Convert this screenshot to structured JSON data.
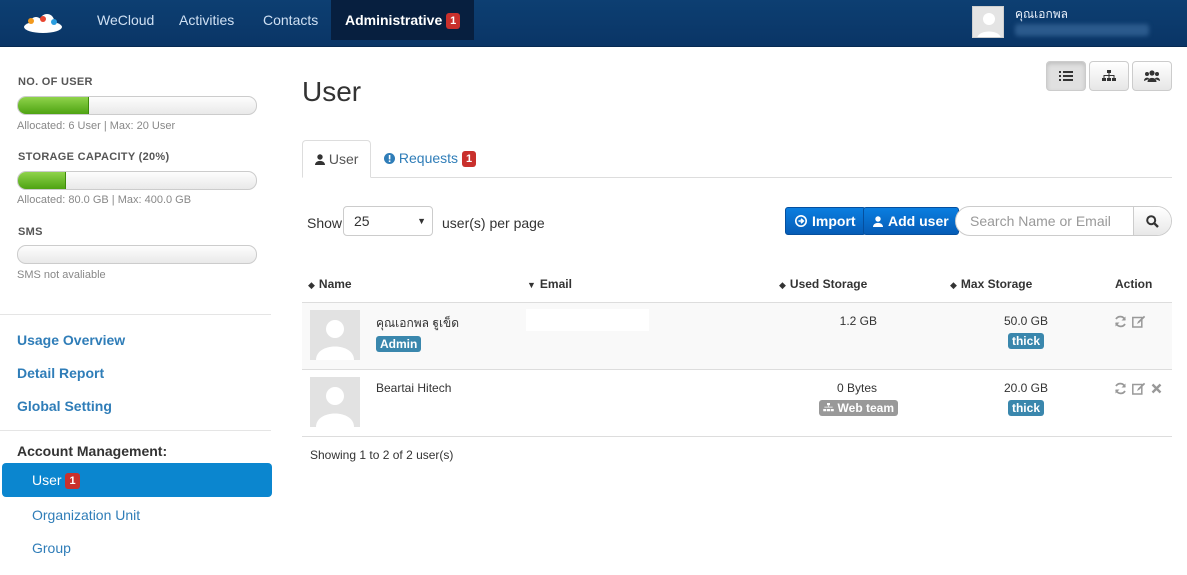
{
  "nav": {
    "items": [
      {
        "label": "WeCloud"
      },
      {
        "label": "Activities"
      },
      {
        "label": "Contacts"
      },
      {
        "label": "Administrative",
        "badge": "1"
      }
    ],
    "user_name": "คุณเอกพล",
    "logo_icon": "cloud-logo-icon"
  },
  "sidebar": {
    "users_meter": {
      "label": "NO. OF USER",
      "fill": 0.3,
      "caption": "Allocated: 6 User | Max: 20 User"
    },
    "storage_meter": {
      "label": "STORAGE CAPACITY (20%)",
      "fill": 0.2,
      "caption": "Allocated: 80.0 GB | Max: 400.0 GB"
    },
    "sms_meter": {
      "label": "SMS",
      "fill": 0,
      "caption": "SMS not avaliable"
    },
    "links": [
      "Usage Overview",
      "Detail Report",
      "Global Setting"
    ],
    "account_heading": "Account Management:",
    "active_item": {
      "label": "User",
      "badge": "1"
    },
    "sub_items": [
      "Organization Unit",
      "Group"
    ]
  },
  "main": {
    "title": "User",
    "tabs": [
      {
        "label": "User",
        "icon": "user-icon"
      },
      {
        "label": "Requests",
        "icon": "info-circle-icon",
        "badge": "1"
      }
    ],
    "show_label": "Show",
    "per_page_value": "25",
    "per_page_label": "user(s) per page",
    "import_label": "Import",
    "add_user_label": "Add user",
    "search_placeholder": "Search Name or Email",
    "columns": [
      "Name",
      "Email",
      "Used Storage",
      "Max Storage",
      "Action"
    ],
    "rows": [
      {
        "name": "คุณเอกพล ฐูเข็ด",
        "role": "Admin",
        "used": "1.2 GB",
        "team": "",
        "max": "50.0 GB",
        "tier": "thick"
      },
      {
        "name": "Beartai Hitech",
        "role": "",
        "used": "0 Bytes",
        "team": "Web team",
        "max": "20.0 GB",
        "tier": "thick"
      }
    ],
    "showing": "Showing 1 to 2 of 2 user(s)"
  },
  "colors": {
    "nav_bg": "#0d3f72",
    "accent": "#0b86cf",
    "link": "#2f7db8",
    "badge": "#c9302c",
    "tag": "#3a87ad"
  }
}
